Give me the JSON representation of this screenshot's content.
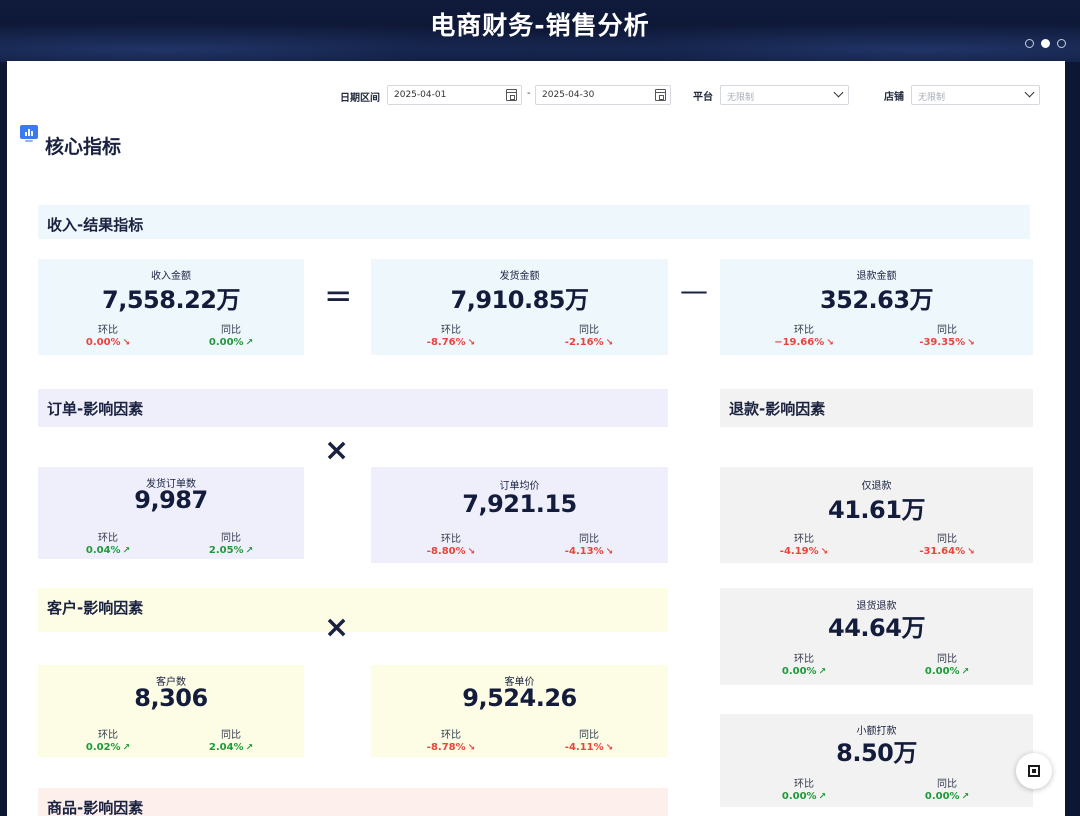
{
  "header": {
    "title": "电商财务-销售分析"
  },
  "filters": {
    "date_label": "日期区间",
    "date_start": "2025-04-01",
    "date_sep": "-",
    "date_end": "2025-04-30",
    "platform_label": "平台",
    "platform_value": "无限制",
    "shop_label": "店铺",
    "shop_value": "无限制"
  },
  "section": {
    "title": "核心指标"
  },
  "bands": {
    "revenue": "收入-结果指标",
    "orders": "订单-影响因素",
    "refunds": "退款-影响因素",
    "customers": "客户-影响因素",
    "products": "商品-影响因素"
  },
  "operators": {
    "equals": "=",
    "minus": "—",
    "times": "×"
  },
  "sublabels": {
    "mom": "环比",
    "yoy": "同比"
  },
  "cards": {
    "revenue": {
      "label": "收入金额",
      "value": "7,558.22万",
      "mom": "0.00%",
      "mom_dir": "down",
      "yoy": "0.00%",
      "yoy_dir": "up"
    },
    "shipped": {
      "label": "发货金额",
      "value": "7,910.85万",
      "mom": "-8.76%",
      "mom_dir": "down",
      "yoy": "-2.16%",
      "yoy_dir": "down"
    },
    "refund": {
      "label": "退款金额",
      "value": "352.63万",
      "mom": "−19.66%",
      "mom_dir": "down",
      "yoy": "-39.35%",
      "yoy_dir": "down"
    },
    "orders": {
      "label": "发货订单数",
      "value": "9,987",
      "mom": "0.04%",
      "mom_dir": "up",
      "yoy": "2.05%",
      "yoy_dir": "up"
    },
    "avg_order": {
      "label": "订单均价",
      "value": "7,921.15",
      "mom": "-8.80%",
      "mom_dir": "down",
      "yoy": "-4.13%",
      "yoy_dir": "down"
    },
    "refund_only": {
      "label": "仅退款",
      "value": "41.61万",
      "mom": "-4.19%",
      "mom_dir": "down",
      "yoy": "-31.64%",
      "yoy_dir": "down"
    },
    "return_refund": {
      "label": "退货退款",
      "value": "44.64万",
      "mom": "0.00%",
      "mom_dir": "up",
      "yoy": "0.00%",
      "yoy_dir": "up"
    },
    "customers": {
      "label": "客户数",
      "value": "8,306",
      "mom": "0.02%",
      "mom_dir": "up",
      "yoy": "2.04%",
      "yoy_dir": "up"
    },
    "avg_customer": {
      "label": "客单价",
      "value": "9,524.26",
      "mom": "-8.78%",
      "mom_dir": "down",
      "yoy": "-4.11%",
      "yoy_dir": "down"
    },
    "small_pay": {
      "label": "小额打款",
      "value": "8.50万",
      "mom": "0.00%",
      "mom_dir": "up",
      "yoy": "0.00%",
      "yoy_dir": "up"
    }
  },
  "arrows": {
    "down": "↘",
    "up": "↗"
  },
  "colors": {
    "revenue_band": "#eef7fc",
    "orders_band": "#efeffc",
    "refund_band": "#f2f2f2",
    "customers_band": "#fdfde6",
    "products_band": "#fdefec",
    "down": "#e8443c",
    "up": "#1e9a3a",
    "header_bg": "#0d1633",
    "accent": "#3a7cf0"
  },
  "icons": {
    "calendar": "calendar-icon",
    "chevron": "chevron-down-icon",
    "core": "bar-chart-icon",
    "floating": "screenshot-icon"
  }
}
